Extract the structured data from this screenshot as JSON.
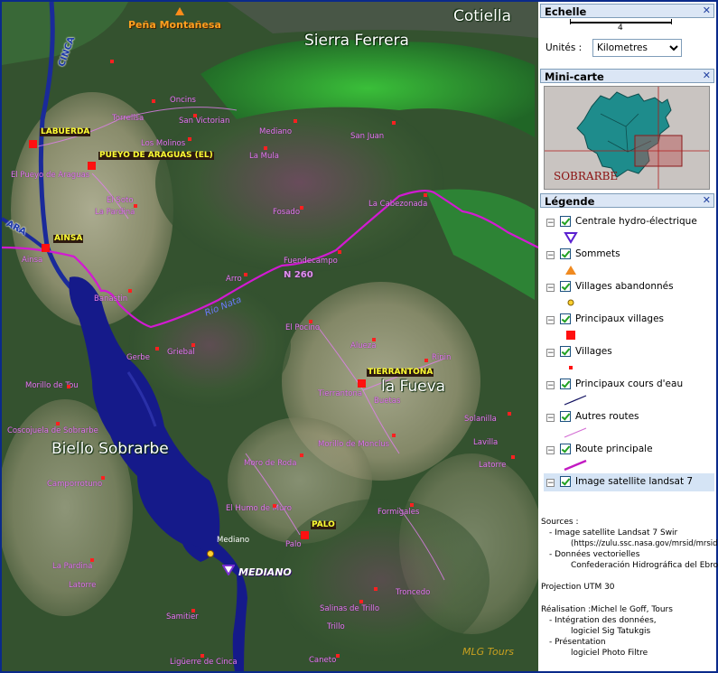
{
  "map": {
    "title_labels": {
      "sierra_ferrera": "Sierra Ferrera",
      "cotiella": "Cotiella",
      "biello_sobrarbe": "Biello Sobrarbe",
      "la_fueva": "la Fueva"
    },
    "peak": "Peña Montañesa",
    "main_villages": {
      "labuerda": "LABUERDA",
      "pueyo": "PUEYO DE ARAGUAS (EL)",
      "ainsa": "AINSA",
      "tierrantona": "TIERRANTONA",
      "palo": "PALO",
      "mediano": "MEDIANO"
    },
    "rivers": {
      "cinca": "CINCA",
      "ara": "ARA",
      "rio_nata": "Rio Nata"
    },
    "road": "N 260",
    "villages": {
      "oncins": "Oncins",
      "torrelisa": "Torrelisa",
      "san_victorian": "San Victorian",
      "mediano_n": "Mediano",
      "san_juan": "San Juan",
      "los_molinos": "Los Molinos",
      "la_mula": "La Mula",
      "el_pueyo": "El Pueyo de Araguas",
      "el_soto": "El Soto",
      "la_pardina_n": "La Pardina",
      "fosado": "Fosado",
      "la_cabezonada": "La Cabezonada",
      "ainsa_s": "Ainsa",
      "fuendecampo": "Fuendecampo",
      "arro": "Arro",
      "banastin": "Banastin",
      "el_pocino": "El Pocino",
      "alueza": "Alueza",
      "rinin": "Rinin",
      "gerbe": "Gerbe",
      "griebal": "Griebal",
      "morillo_tou": "Morillo de Tou",
      "tierrantona_s": "Tierrantona",
      "buetas": "Buetas",
      "coscojuela": "Coscojuela de Sobrarbe",
      "solanilla": "Solanilla",
      "morillo_monclus": "Morillo de Monclus",
      "lavilla": "Lavilla",
      "latorre_e": "Latorre",
      "moro_roda": "Moro de Roda",
      "camporrotuno": "Camporrotuno",
      "humo_muro": "El Humo de Muro",
      "formigales": "Formigales",
      "mediano_s": "Mediano",
      "palo_s": "Palo",
      "la_pardina_s": "La Pardina",
      "latorre_w": "Latorre",
      "troncedo": "Troncedo",
      "samitier": "Samitier",
      "salinas": "Salinas de Trillo",
      "trillo": "Trillo",
      "ligueire": "Ligüerre de Cinca",
      "caneto": "Caneto"
    },
    "watermark": "MLG  Tours"
  },
  "panel": {
    "echelle": {
      "title": "Echelle",
      "scale_number": "4",
      "units_label": "Unités :",
      "units_value": "Kilometres",
      "units_options": [
        "Kilometres"
      ]
    },
    "minicarte": {
      "title": "Mini-carte",
      "region": "SOBRARBE"
    },
    "legende": {
      "title": "Légende",
      "items": [
        {
          "label": "Centrale hydro-électrique",
          "symbol": "triangle-down-icon"
        },
        {
          "label": "Sommets",
          "symbol": "triangle-up-icon"
        },
        {
          "label": "Villages abandonnés",
          "symbol": "circle-icon"
        },
        {
          "label": "Principaux villages",
          "symbol": "big-square-icon"
        },
        {
          "label": "Villages",
          "symbol": "small-square-icon"
        },
        {
          "label": "Principaux cours d'eau",
          "symbol": "line-dark-icon"
        },
        {
          "label": "Autres routes",
          "symbol": "line-pink-icon"
        },
        {
          "label": "Route principale",
          "symbol": "line-magenta-icon"
        },
        {
          "label": "Image satellite landsat 7",
          "symbol": ""
        }
      ]
    },
    "sources": {
      "head": "Sources :",
      "l1": "- Image satellite Landsat 7 Swir",
      "l2": "(https://zulu.ssc.nasa.gov/mrsid/mrsid",
      "l3": "- Données vectorielles",
      "l4": "Confederación Hidrográfica del Ebro",
      "projection": "Projection UTM 30",
      "realisation": "Réalisation :Michel le Goff, Tours",
      "r1": "- Intégration des données,",
      "r2": "logiciel Sig Tatukgis",
      "r3": "- Présentation",
      "r4": "logiciel Photo Filtre"
    }
  },
  "colors": {
    "water": "#151a8a",
    "road_main": "#d21ad2",
    "village": "#ff2020",
    "panel_header": "#dbe6f5",
    "minimap_land": "#1e8c8c"
  }
}
